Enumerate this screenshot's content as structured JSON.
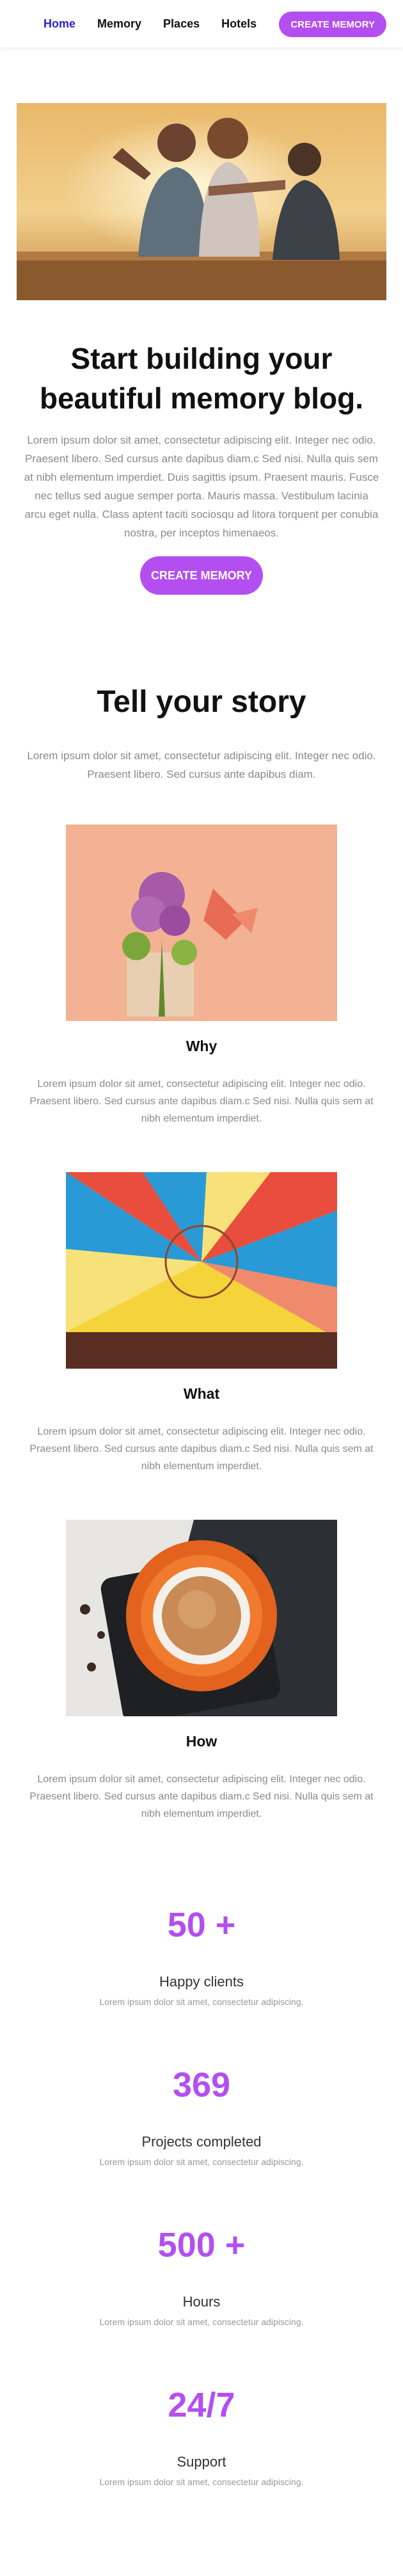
{
  "nav": {
    "links": [
      "Home",
      "Memory",
      "Places",
      "Hotels"
    ],
    "cta": "CREATE MEMORY"
  },
  "hero": {
    "title": "Start building your beautiful memory blog.",
    "text": "Lorem ipsum dolor sit amet, consectetur adipiscing elit. Integer nec odio. Praesent libero. Sed cursus ante dapibus diam.c Sed nisi. Nulla quis sem at nibh elementum imperdiet. Duis sagittis ipsum. Praesent mauris. Fusce nec tellus sed augue semper porta. Mauris massa. Vestibulum lacinia arcu eget nulla. Class aptent taciti sociosqu ad litora torquent per conubia nostra, per inceptos himenaeos.",
    "button": "CREATE MEMORY"
  },
  "story": {
    "title": "Tell your story",
    "intro": "Lorem ipsum dolor sit amet, consectetur adipiscing elit. Integer nec odio. Praesent libero. Sed cursus ante dapibus diam.",
    "items": [
      {
        "title": "Why",
        "text": "Lorem ipsum dolor sit amet, consectetur adipiscing elit. Integer nec odio. Praesent libero. Sed cursus ante dapibus diam.c Sed nisi. Nulla quis sem at nibh elementum imperdiet."
      },
      {
        "title": "What",
        "text": "Lorem ipsum dolor sit amet, consectetur adipiscing elit. Integer nec odio. Praesent libero. Sed cursus ante dapibus diam.c Sed nisi. Nulla quis sem at nibh elementum imperdiet."
      },
      {
        "title": "How",
        "text": "Lorem ipsum dolor sit amet, consectetur adipiscing elit. Integer nec odio. Praesent libero. Sed cursus ante dapibus diam.c Sed nisi. Nulla quis sem at nibh elementum imperdiet."
      }
    ]
  },
  "stats": [
    {
      "value": "50 +",
      "label": "Happy clients",
      "sub": "Lorem ipsum dolor sit amet, consectetur adipiscing."
    },
    {
      "value": "369",
      "label": "Projects completed",
      "sub": "Lorem ipsum dolor sit amet, consectetur adipiscing."
    },
    {
      "value": "500 +",
      "label": "Hours",
      "sub": "Lorem ipsum dolor sit amet, consectetur adipiscing."
    },
    {
      "value": "24/7",
      "label": "Support",
      "sub": "Lorem ipsum dolor sit amet, consectetur adipiscing."
    }
  ],
  "colors": {
    "accent": "#b34ff0",
    "active_nav": "#2a1fd6",
    "muted_text": "#8a8a8a"
  }
}
